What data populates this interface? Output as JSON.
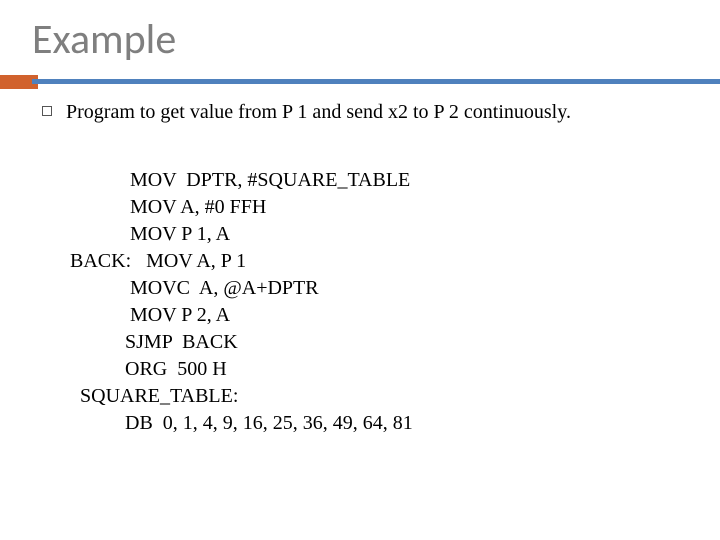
{
  "title": "Example",
  "bullet": "Program to get value from P 1 and send x2 to P 2 continuously.",
  "code": {
    "l1": "            MOV  DPTR, #SQUARE_TABLE",
    "l2": "            MOV A, #0 FFH",
    "l3": "            MOV P 1, A",
    "l4": "BACK:   MOV A, P 1",
    "l5": "            MOVC  A, @A+DPTR",
    "l6": "            MOV P 2, A",
    "l7": "           SJMP  BACK",
    "l8": "           ORG  500 H",
    "l9": "  SQUARE_TABLE:",
    "l10": "           DB  0, 1, 4, 9, 16, 25, 36, 49, 64, 81"
  }
}
